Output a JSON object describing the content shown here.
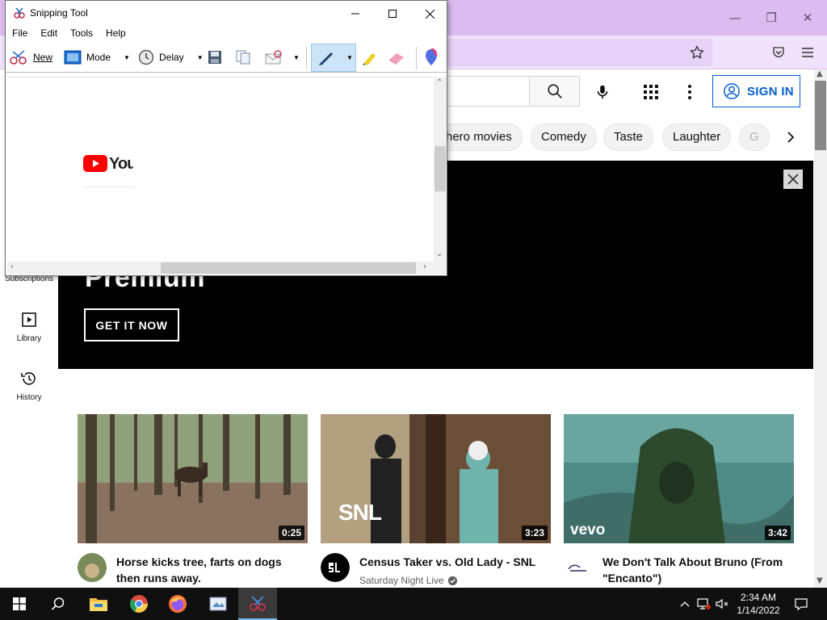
{
  "snipping_tool": {
    "title": "Snipping Tool",
    "menu": [
      "File",
      "Edit",
      "Tools",
      "Help"
    ],
    "toolbar": {
      "new_label": "New",
      "mode_label": "Mode",
      "delay_label": "Delay"
    },
    "captured_logo_text": "You"
  },
  "youtube": {
    "sign_in_label": "SIGN IN",
    "chips": [
      "hero movies",
      "Comedy",
      "Taste",
      "Laughter",
      "G"
    ],
    "sidebar": [
      {
        "label": "Subscriptions",
        "icon": "subscriptions-icon"
      },
      {
        "label": "Library",
        "icon": "library-icon"
      },
      {
        "label": "History",
        "icon": "history-icon"
      }
    ],
    "banner": {
      "title": "Premium",
      "button_label": "GET IT NOW"
    },
    "videos": [
      {
        "title": "Horse kicks tree, farts on dogs then runs away.",
        "channel": "",
        "duration": "0:25",
        "verified": false
      },
      {
        "title": "Census Taker vs. Old Lady - SNL",
        "channel": "Saturday Night Live",
        "duration": "3:23",
        "verified": true,
        "thumb_badge": "SNL"
      },
      {
        "title": "We Don't Talk About Bruno (From \"Encanto\")",
        "channel": "",
        "duration": "3:42",
        "verified": false,
        "thumb_badge": "vevo"
      }
    ]
  },
  "taskbar": {
    "apps": [
      "windows-start",
      "search",
      "file-explorer",
      "chrome",
      "firefox",
      "paint",
      "snipping-tool"
    ],
    "time": "2:34 AM",
    "date": "1/14/2022"
  },
  "colors": {
    "firefox_titlebar": "#dcbcf0",
    "youtube_blue": "#065fd4",
    "youtube_red": "#ff0000",
    "taskbar": "#101010"
  }
}
